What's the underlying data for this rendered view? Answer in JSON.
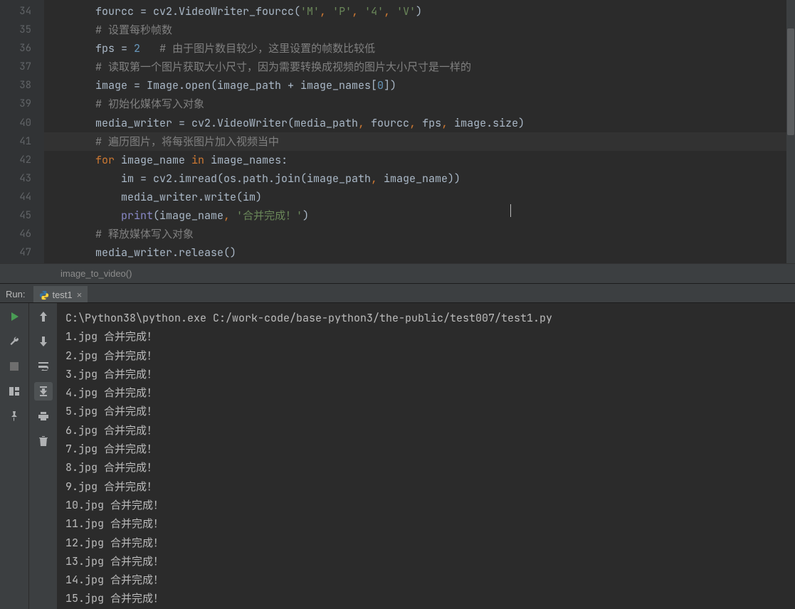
{
  "gutter": [
    "34",
    "35",
    "36",
    "37",
    "38",
    "39",
    "40",
    "41",
    "42",
    "43",
    "44",
    "45",
    "46",
    "47"
  ],
  "code": {
    "l34": {
      "i": "        ",
      "pre": "fourcc = cv2.VideoWriter_fourcc(",
      "s1": "'M'",
      "c1": ", ",
      "s2": "'P'",
      "c2": ", ",
      "s3": "'4'",
      "c3": ", ",
      "s4": "'V'",
      "end": ")"
    },
    "l35": {
      "i": "        ",
      "t": "# 设置每秒帧数"
    },
    "l36": {
      "i": "        ",
      "a": "fps = ",
      "n": "2",
      "sp": "   ",
      "c": "# 由于图片数目较少，这里设置的帧数比较低"
    },
    "l37": {
      "i": "        ",
      "t": "# 读取第一个图片获取大小尺寸，因为需要转换成视频的图片大小尺寸是一样的"
    },
    "l38": {
      "i": "        ",
      "a": "image = Image.open(image_path + image_names[",
      "n": "0",
      "b": "])"
    },
    "l39": {
      "i": "        ",
      "t": "# 初始化媒体写入对象"
    },
    "l40": {
      "i": "        ",
      "a": "media_writer = cv2.VideoWriter(media_path",
      "b": ", ",
      "c": "fourcc",
      "d": ", ",
      "e": "fps",
      "f": ", ",
      "g": "image.size)"
    },
    "l41": {
      "i": "        ",
      "t": "# 遍历图片，将每张图片加入视频当中"
    },
    "l42": {
      "i": "        ",
      "k1": "for ",
      "v": "image_name ",
      "k2": "in ",
      "r": "image_names:"
    },
    "l43": {
      "i": "            ",
      "a": "im = cv2.imread(os.path.join(image_path",
      "b": ", ",
      "c": "image_name))"
    },
    "l44": {
      "i": "            ",
      "a": "media_writer.write(im)"
    },
    "l45": {
      "i": "            ",
      "fn": "print",
      "a": "(image_name",
      "b": ", ",
      "s": "'合并完成！'",
      "c": ")"
    },
    "l46": {
      "i": "        ",
      "t": "# 释放媒体写入对象"
    },
    "l47": {
      "i": "        ",
      "a": "media_writer.release()"
    }
  },
  "breadcrumb": "image_to_video()",
  "run": {
    "label": "Run:",
    "tab": "test1"
  },
  "console": {
    "cmd": "C:\\Python38\\python.exe C:/work-code/base-python3/the-public/test007/test1.py",
    "lines": [
      "1.jpg 合并完成！",
      "2.jpg 合并完成！",
      "3.jpg 合并完成！",
      "4.jpg 合并完成！",
      "5.jpg 合并完成！",
      "6.jpg 合并完成！",
      "7.jpg 合并完成！",
      "8.jpg 合并完成！",
      "9.jpg 合并完成！",
      "10.jpg 合并完成！",
      "11.jpg 合并完成！",
      "12.jpg 合并完成！",
      "13.jpg 合并完成！",
      "14.jpg 合并完成！",
      "15.jpg 合并完成！"
    ]
  }
}
